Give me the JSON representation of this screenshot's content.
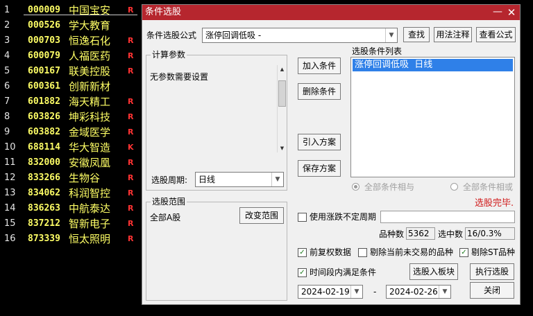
{
  "stock_list": [
    {
      "num": "1",
      "code": "000009",
      "name": "中国宝安",
      "flag": "R"
    },
    {
      "num": "2",
      "code": "000526",
      "name": "学大教育",
      "flag": ""
    },
    {
      "num": "3",
      "code": "000703",
      "name": "恒逸石化",
      "flag": "R"
    },
    {
      "num": "4",
      "code": "600079",
      "name": "人福医药",
      "flag": "R"
    },
    {
      "num": "5",
      "code": "600167",
      "name": "联美控股",
      "flag": "R"
    },
    {
      "num": "6",
      "code": "600361",
      "name": "创新新材",
      "flag": ""
    },
    {
      "num": "7",
      "code": "601882",
      "name": "海天精工",
      "flag": "R"
    },
    {
      "num": "8",
      "code": "603826",
      "name": "坤彩科技",
      "flag": "R"
    },
    {
      "num": "9",
      "code": "603882",
      "name": "金域医学",
      "flag": "R"
    },
    {
      "num": "10",
      "code": "688114",
      "name": "华大智造",
      "flag": "K"
    },
    {
      "num": "11",
      "code": "832000",
      "name": "安徽凤凰",
      "flag": "R"
    },
    {
      "num": "12",
      "code": "833266",
      "name": "生物谷",
      "flag": "R"
    },
    {
      "num": "13",
      "code": "834062",
      "name": "科润智控",
      "flag": "R"
    },
    {
      "num": "14",
      "code": "836263",
      "name": "中航泰达",
      "flag": "R"
    },
    {
      "num": "15",
      "code": "837212",
      "name": "智新电子",
      "flag": "R"
    },
    {
      "num": "16",
      "code": "873339",
      "name": "恒太照明",
      "flag": "R"
    }
  ],
  "dialog": {
    "title": "条件选股",
    "min_glyph": "—",
    "close_glyph": "✕",
    "formula_label": "条件选股公式",
    "formula_value": "涨停回调低吸 -",
    "btn_find": "查找",
    "btn_usage": "用法注释",
    "btn_view": "查看公式",
    "params_group": "计算参数",
    "params_text": "无参数需要设置",
    "period_label": "选股周期:",
    "period_value": "日线",
    "btn_add": "加入条件",
    "btn_delete": "删除条件",
    "btn_import": "引入方案",
    "btn_save": "保存方案",
    "list_title": "选股条件列表",
    "list_items": [
      "涨停回调低吸  日线"
    ],
    "radio_and": "全部条件相与",
    "radio_or": "全部条件相或",
    "status": "选股完毕.",
    "range_group": "选股范围",
    "range_value": "全部A股",
    "btn_change_range": "改变范围",
    "use_variable_period": "使用涨跌不定周期",
    "count_label": "品种数",
    "count_value": "5362",
    "selected_label": "选中数",
    "selected_value": "16/0.3%",
    "chk_prior": "前复权数据",
    "chk_remove_untraded": "剔除当前未交易的品种",
    "chk_remove_st": "剔除ST品种",
    "chk_time_range": "时间段内满足条件",
    "btn_to_block": "选股入板块",
    "btn_execute": "执行选股",
    "date_from": "2024-02-19",
    "date_sep": "-",
    "date_to": "2024-02-26",
    "btn_close": "关闭",
    "check_mark": "✓"
  },
  "colors": {
    "title_bar": "#b6262e",
    "status_text": "#d01818",
    "stock_text": "#ffff66",
    "flag": "#ff3333",
    "selection": "#2f80e8"
  }
}
